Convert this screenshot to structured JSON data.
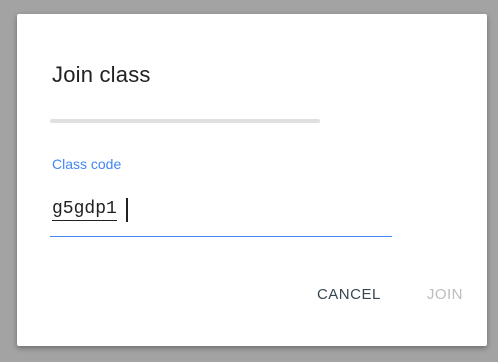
{
  "dialog": {
    "title": "Join class",
    "progress": 0,
    "field": {
      "label": "Class code",
      "value": "g5gdp1"
    },
    "actions": {
      "cancel_label": "CANCEL",
      "join_label": "JOIN"
    }
  },
  "colors": {
    "accent": "#4285f4",
    "disabled": "#bdbdbd"
  }
}
